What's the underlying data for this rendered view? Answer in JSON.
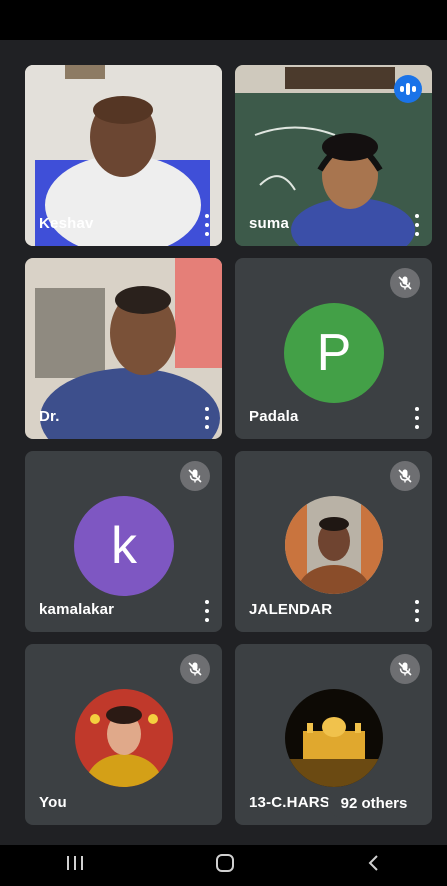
{
  "participants": [
    {
      "name": "Keshav",
      "muted": false,
      "speaking": false
    },
    {
      "name": "suma",
      "muted": false,
      "speaking": true
    },
    {
      "name": "Dr.",
      "muted": false,
      "speaking": false
    },
    {
      "name": "Padala",
      "muted": true,
      "avatar_letter": "P",
      "avatar_color": "#43a047"
    },
    {
      "name": "kamalakar",
      "muted": true,
      "avatar_letter": "k",
      "avatar_color": "#7e57c2"
    },
    {
      "name": "JALENDAR",
      "muted": true
    },
    {
      "name": "You",
      "muted": true
    },
    {
      "name": "13-C.HARS",
      "muted": true
    }
  ],
  "others_label": "92 others",
  "colors": {
    "background": "#202124",
    "tile": "#3c4043",
    "accent": "#1a73e8"
  },
  "icons": [
    "mic-off-icon",
    "more-vert-icon",
    "speaking-indicator-icon",
    "recent-apps-icon",
    "home-icon",
    "back-icon"
  ]
}
